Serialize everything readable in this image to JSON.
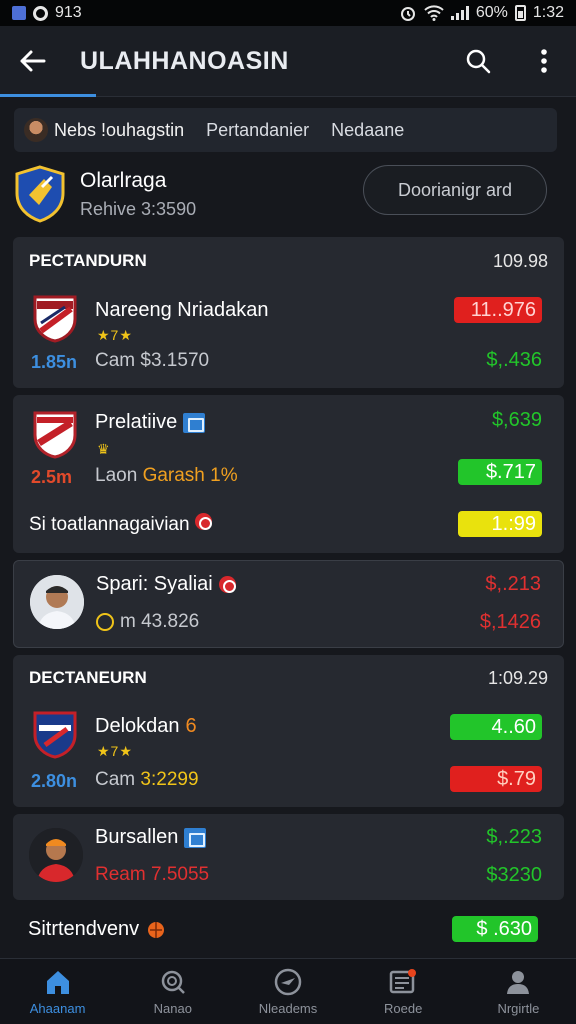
{
  "status": {
    "left_text": "913",
    "battery": "60%",
    "time": "1:32"
  },
  "appbar": {
    "title": "ULAHHANOASIN"
  },
  "filters": {
    "chip": "Nebs !ouhagstin",
    "option1": "Pertandanier",
    "option2": "Nedaane"
  },
  "team": {
    "name": "Olarlraga",
    "sub": "Rehive 3:3590",
    "button": "Doorianigr ard"
  },
  "section1": {
    "label": "PECTANDURN",
    "value": "109.98"
  },
  "rows": [
    {
      "name": "Nareeng Nriadakan",
      "stars": "★7★",
      "left": "1.85n",
      "sub": "Cam $3.1570",
      "top_value": "11..976",
      "bottom_value": "$,.436"
    },
    {
      "name": "Prelatiive",
      "stars": "♛",
      "left": "2.5m",
      "sub_a": "Laon",
      "sub_b": "Garash 1%",
      "top_value": "$,639",
      "bottom_value": "$.717"
    },
    {
      "footer_text": "Si toatlannagaivian",
      "footer_value": "1.:99"
    },
    {
      "name": "Spari: Syaliai",
      "sub": "m 43.826",
      "top_value": "$,.213",
      "bottom_value": "$,1426"
    }
  ],
  "section2": {
    "label": "DECTANEURN",
    "value": "1:09.29"
  },
  "rows2": [
    {
      "name": "Delokdan",
      "name_num": "6",
      "stars": "★7★",
      "left": "2.80n",
      "sub_a": "Cam",
      "sub_b": "3:2299",
      "top_value": "4..60",
      "bottom_value": "$.79"
    },
    {
      "name": "Bursallen",
      "sub_a": "Ream",
      "sub_b": "7.5055",
      "top_value": "$,.223",
      "bottom_value": "$3230"
    }
  ],
  "footer_row": {
    "text": "Sitrtendvenv",
    "value": "$ .630"
  },
  "nav": [
    {
      "label": "Ahaanam",
      "icon": "home-icon"
    },
    {
      "label": "Nanao",
      "icon": "search-icon"
    },
    {
      "label": "Nleadems",
      "icon": "plane-icon"
    },
    {
      "label": "Roede",
      "icon": "news-icon"
    },
    {
      "label": "Nrgirtle",
      "icon": "person-icon"
    }
  ],
  "colors": {
    "accent": "#3d8fe0",
    "green": "#22c52a",
    "red": "#e0201e",
    "yellow": "#e9e20d"
  }
}
